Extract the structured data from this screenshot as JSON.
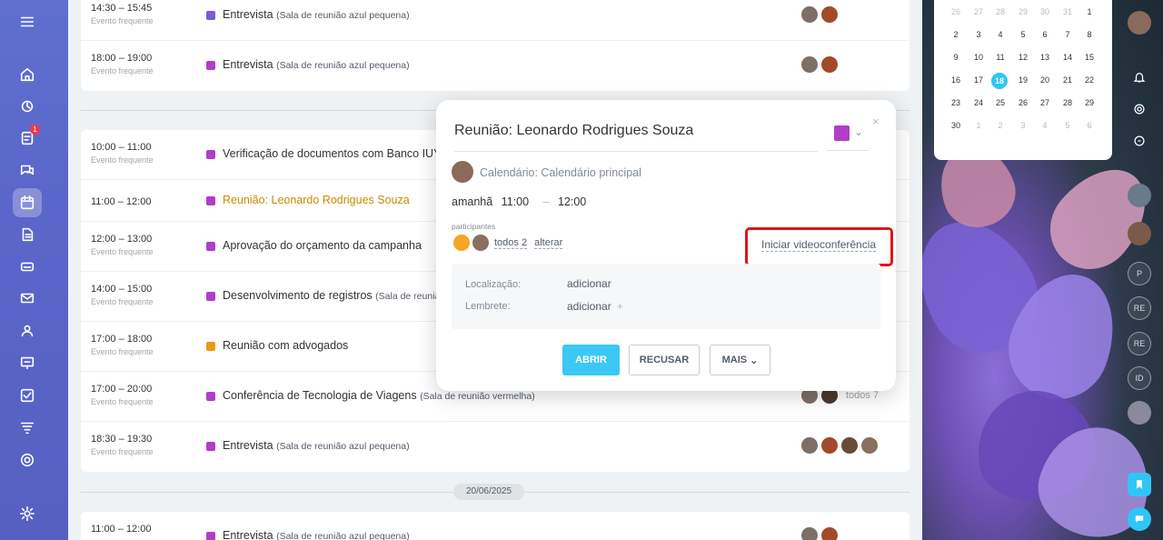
{
  "sidebar": {
    "notification_badge": "1"
  },
  "day1_events": [
    {
      "time": "14:30 – 15:45",
      "freq": "Evento frequente",
      "title": "Entrevista",
      "room": "(Sala de reunião azul pequena)",
      "color": "#7b5bd9"
    },
    {
      "time": "18:00 – 19:00",
      "freq": "Evento frequente",
      "title": "Entrevista",
      "room": "(Sala de reunião azul pequena)",
      "color": "#b13ec7"
    }
  ],
  "day2_events": [
    {
      "time": "10:00 – 11:00",
      "freq": "Evento frequente",
      "title": "Verificação de documentos com Banco IUY",
      "room": "(S",
      "color": "#b13ec7"
    },
    {
      "time": "11:00 – 12:00",
      "freq": "",
      "title": "Reunião: Leonardo Rodrigues Souza",
      "room": "",
      "color": "#b13ec7"
    },
    {
      "time": "12:00 – 13:00",
      "freq": "Evento frequente",
      "title": "Aprovação do orçamento da campanha",
      "room": "",
      "color": "#b13ec7"
    },
    {
      "time": "14:00 – 15:00",
      "freq": "Evento frequente",
      "title": "Desenvolvimento de registros",
      "room": "(Sala de reunião",
      "color": "#b13ec7"
    },
    {
      "time": "17:00 – 18:00",
      "freq": "Evento frequente",
      "title": "Reunião com advogados",
      "room": "",
      "color": "#e89b16"
    },
    {
      "time": "17:00 – 20:00",
      "freq": "Evento frequente",
      "title": "Conferência de Tecnologia de Viagens",
      "room": "(Sala de reunião vermelha)",
      "color": "#b13ec7",
      "more": "todos 7"
    },
    {
      "time": "18:30 – 19:30",
      "freq": "Evento frequente",
      "title": "Entrevista",
      "room": "(Sala de reunião azul pequena)",
      "color": "#b13ec7"
    }
  ],
  "date_separator": "20/06/2025",
  "day3_events": [
    {
      "time": "11:00 – 12:00",
      "freq": "",
      "title": "Entrevista",
      "room": "(Sala de reunião azul pequena)",
      "color": "#b13ec7"
    }
  ],
  "mini_calendar": {
    "rows": [
      [
        "26",
        "27",
        "28",
        "29",
        "30",
        "31",
        "1"
      ],
      [
        "2",
        "3",
        "4",
        "5",
        "6",
        "7",
        "8"
      ],
      [
        "9",
        "10",
        "11",
        "12",
        "13",
        "14",
        "15"
      ],
      [
        "16",
        "17",
        "18",
        "19",
        "20",
        "21",
        "22"
      ],
      [
        "23",
        "24",
        "25",
        "26",
        "27",
        "28",
        "29"
      ],
      [
        "30",
        "1",
        "2",
        "3",
        "4",
        "5",
        "6"
      ]
    ],
    "today": "18"
  },
  "right_rail": [
    "P",
    "RE",
    "RE",
    "ID"
  ],
  "popup": {
    "title": "Reunião: Leonardo Rodrigues Souza",
    "color": "#b13ec7",
    "calendar": "Calendário: Calendário principal",
    "day": "amanhã",
    "start": "11:00",
    "end": "12:00",
    "participants_label": "participantes",
    "participants_link": "todos 2",
    "change_link": "alterar",
    "video_link": "Iniciar videoconferência",
    "location_label": "Localização:",
    "location_value": "adicionar",
    "reminder_label": "Lembrete:",
    "reminder_value": "adicionar",
    "btn_open": "ABRIR",
    "btn_decline": "RECUSAR",
    "btn_more": "MAIS"
  }
}
